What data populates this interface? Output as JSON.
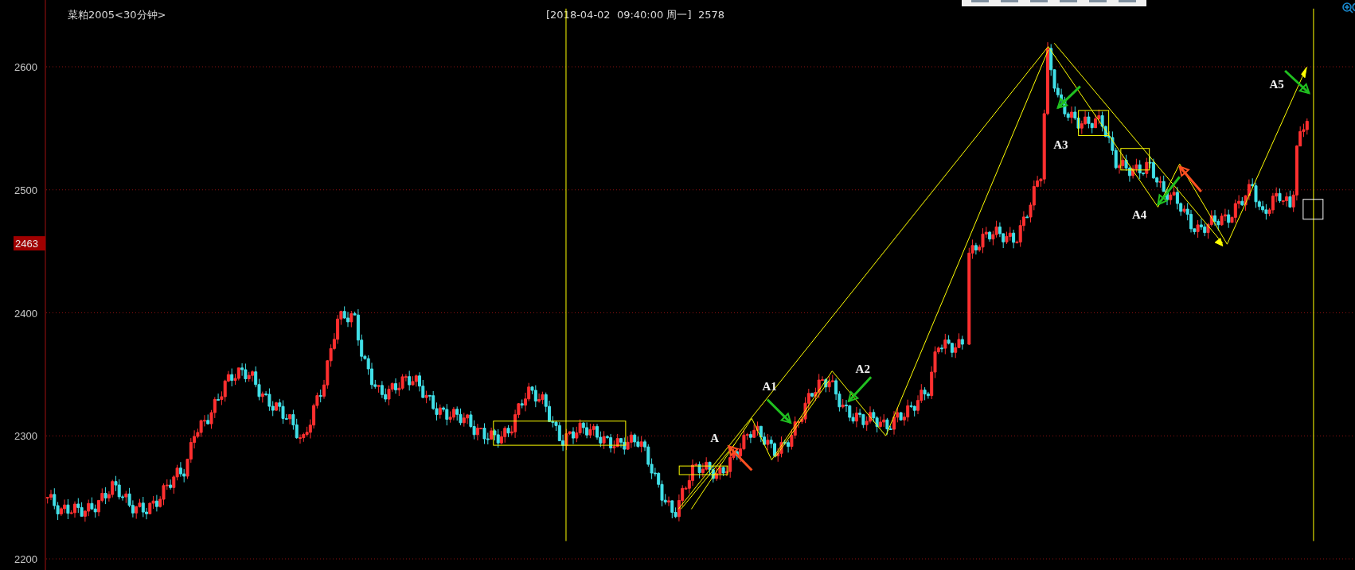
{
  "header": {
    "title": "菜粕2005<30分钟>",
    "timestamp": "[2018-04-02  09:40:00 周一]",
    "price": "2578"
  },
  "price_axis": {
    "ticks": [
      "2600",
      "2500",
      "2400",
      "2300",
      "2200"
    ],
    "current_price": "2463"
  },
  "annotations": [
    {
      "label": "A"
    },
    {
      "label": "A1"
    },
    {
      "label": "A2"
    },
    {
      "label": "A3"
    },
    {
      "label": "A4"
    },
    {
      "label": "A5"
    }
  ]
}
